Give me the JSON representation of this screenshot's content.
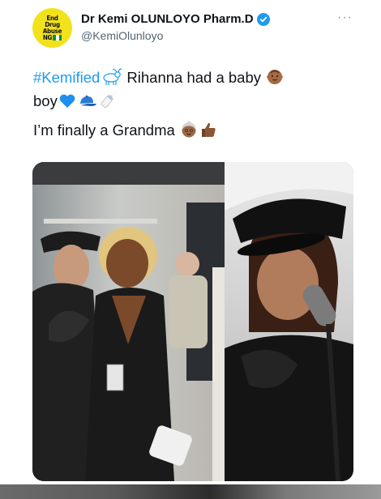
{
  "tweet": {
    "author": {
      "display_name": "Dr Kemi OLUNLOYO Pharm.D",
      "handle": "@KemiOlunloyo",
      "verified": true,
      "avatar_text": [
        "End",
        "Drug",
        "Abuse",
        "NG"
      ]
    },
    "more_label": "···",
    "body": {
      "hashtag": "#Kemified",
      "line1_text": " Rihanna had a baby ",
      "line2_text": "boy",
      "line3_text": "I’m finally a Grandma "
    },
    "emojis": [
      "goat",
      "baby-dark-skin",
      "blue-heart",
      "blue-cap",
      "baby-bottle",
      "older-woman",
      "thumbs-up-dark-skin"
    ],
    "media": {
      "count": 2,
      "left_photo_alt": "Two women posing backstage",
      "right_photo_alt": "Singer in black cap at microphone"
    }
  },
  "colors": {
    "link": "#1d9bf0",
    "verified": "#1d9bf0",
    "secondary_text": "#536471",
    "avatar_bg": "#f2e21b"
  }
}
